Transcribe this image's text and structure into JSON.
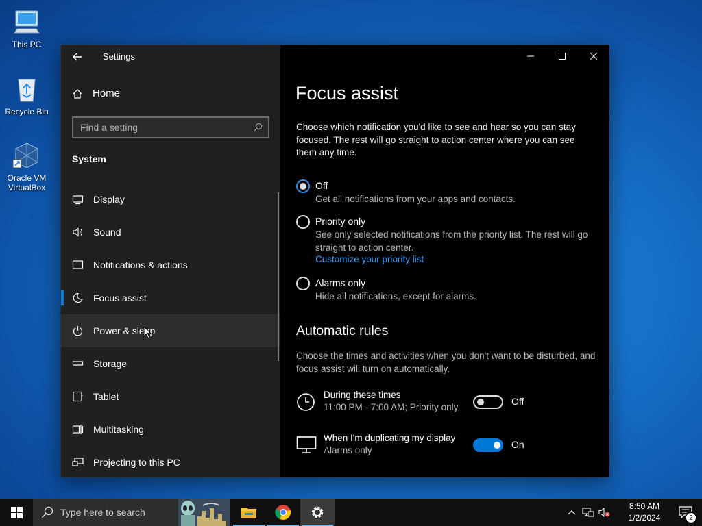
{
  "desktop": {
    "icons": [
      {
        "label": "This PC",
        "icon": "computer-icon"
      },
      {
        "label": "Recycle Bin",
        "icon": "recycle-bin-icon"
      },
      {
        "label": "Oracle VM VirtualBox",
        "icon": "virtualbox-icon"
      }
    ]
  },
  "window": {
    "title": "Settings",
    "home_label": "Home",
    "search_placeholder": "Find a setting",
    "section_label": "System",
    "nav": [
      {
        "label": "Display",
        "icon": "display-icon"
      },
      {
        "label": "Sound",
        "icon": "speaker-icon"
      },
      {
        "label": "Notifications & actions",
        "icon": "notification-icon"
      },
      {
        "label": "Focus assist",
        "icon": "moon-icon",
        "selected": true
      },
      {
        "label": "Power & sleep",
        "icon": "power-icon",
        "hover": true
      },
      {
        "label": "Storage",
        "icon": "storage-icon"
      },
      {
        "label": "Tablet",
        "icon": "tablet-icon"
      },
      {
        "label": "Multitasking",
        "icon": "multitasking-icon"
      },
      {
        "label": "Projecting to this PC",
        "icon": "projecting-icon"
      }
    ]
  },
  "content": {
    "title": "Focus assist",
    "description": "Choose which notification you'd like to see and hear so you can stay focused. The rest will go straight to action center where you can see them any time.",
    "options": [
      {
        "label": "Off",
        "sub": "Get all notifications from your apps and contacts.",
        "checked": true
      },
      {
        "label": "Priority only",
        "sub": "See only selected notifications from the priority list. The rest will go straight to action center.",
        "link": "Customize your priority list",
        "checked": false
      },
      {
        "label": "Alarms only",
        "sub": "Hide all notifications, except for alarms.",
        "checked": false
      }
    ],
    "rules_title": "Automatic rules",
    "rules_description": "Choose the times and activities when you don't want to be disturbed, and focus assist will turn on automatically.",
    "rules": [
      {
        "title": "During these times",
        "sub": "11:00 PM - 7:00 AM; Priority only",
        "state": "Off",
        "on": false,
        "icon": "clock-icon"
      },
      {
        "title": "When I'm duplicating my display",
        "sub": "Alarms only",
        "state": "On",
        "on": true,
        "icon": "monitor-icon"
      }
    ]
  },
  "taskbar": {
    "search_placeholder": "Type here to search",
    "apps": [
      "file-explorer-icon",
      "chrome-icon",
      "settings-icon"
    ],
    "time": "8:50 AM",
    "date": "1/2/2024",
    "notification_count": "2"
  }
}
